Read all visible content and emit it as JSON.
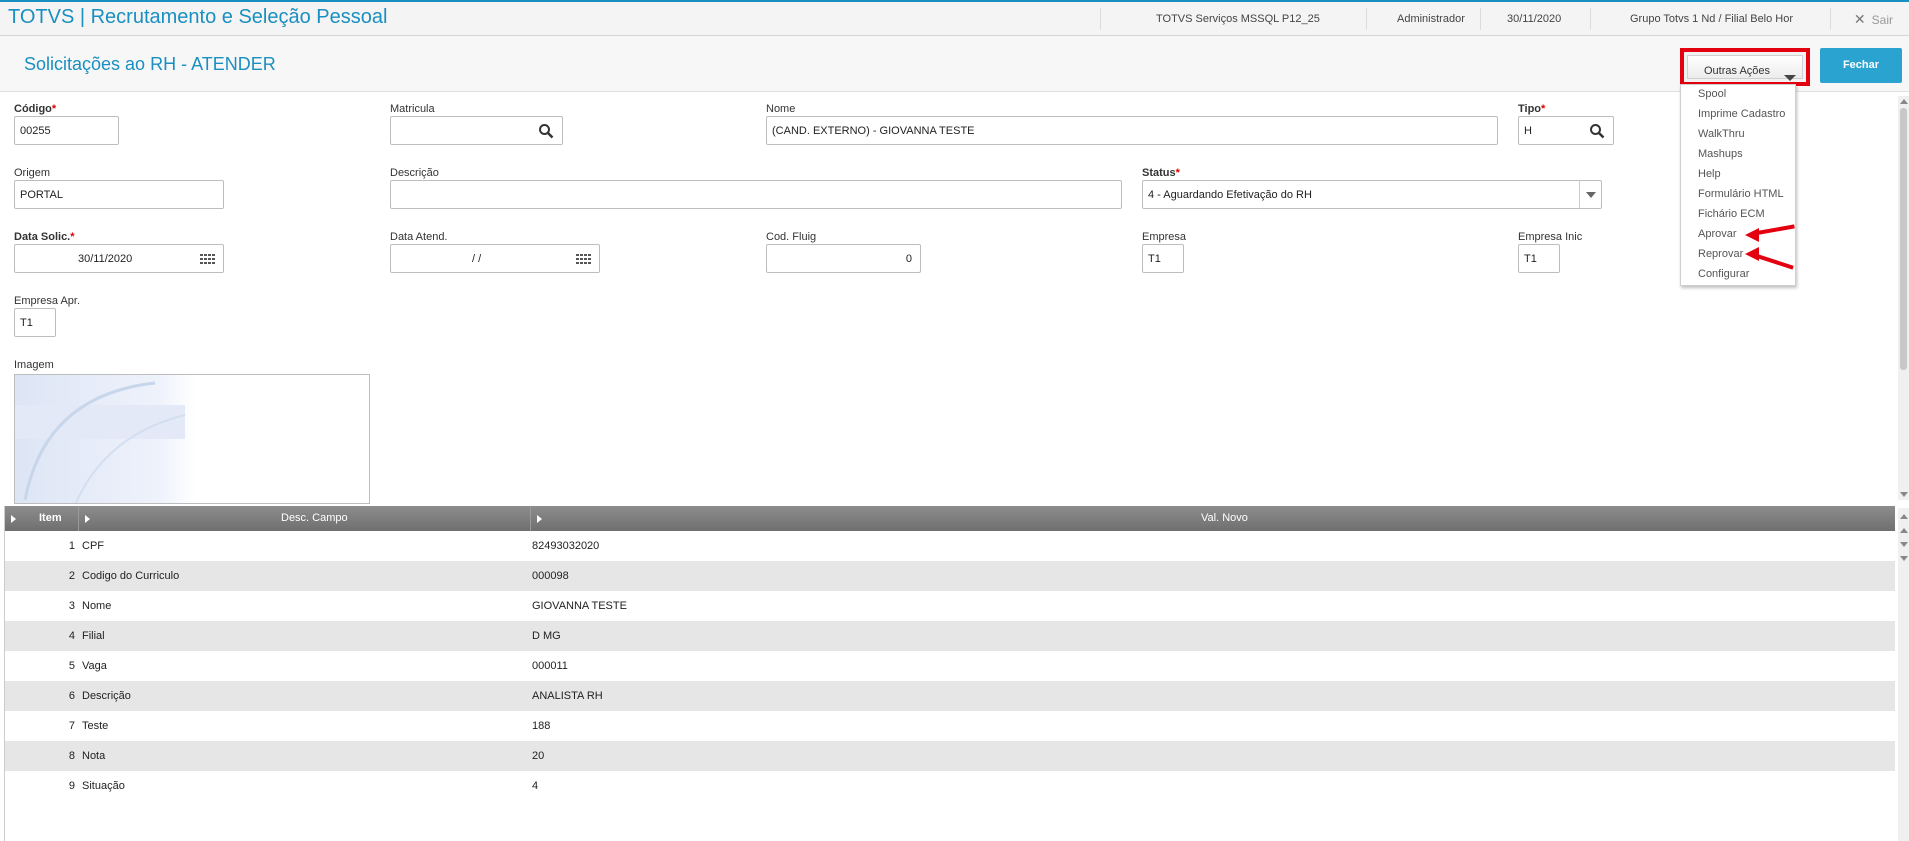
{
  "app": {
    "title": "TOTVS | Recrutamento e Seleção Pessoal",
    "environment": "TOTVS Serviços MSSQL P12_25",
    "user": "Administrador",
    "date": "30/11/2020",
    "branch": "Grupo Totvs 1 Nd / Filial Belo Hor",
    "exit_label": "Sair"
  },
  "page": {
    "title": "Solicitações ao RH - ATENDER",
    "actions_label": "Outras Ações",
    "close_label": "Fechar"
  },
  "actions_menu": {
    "items": [
      "Spool",
      "Imprime Cadastro",
      "WalkThru",
      "Mashups",
      "Help",
      "Formulário HTML",
      "Fichário ECM",
      "Aprovar",
      "Reprovar",
      "Configurar"
    ]
  },
  "form": {
    "codigo": {
      "label": "Código",
      "value": "00255"
    },
    "matricula": {
      "label": "Matricula",
      "value": ""
    },
    "nome": {
      "label": "Nome",
      "value": "(CAND. EXTERNO) - GIOVANNA  TESTE"
    },
    "tipo": {
      "label": "Tipo",
      "value": "H"
    },
    "origem": {
      "label": "Origem",
      "value": "PORTAL"
    },
    "descricao": {
      "label": "Descrição",
      "value": ""
    },
    "status": {
      "label": "Status",
      "value": "4 - Aguardando Efetivação do RH"
    },
    "data_solic": {
      "label": "Data Solic.",
      "value": "30/11/2020"
    },
    "data_atend": {
      "label": "Data Atend.",
      "value": "/  /"
    },
    "cod_fluig": {
      "label": "Cod. Fluig",
      "value": "0"
    },
    "empresa": {
      "label": "Empresa",
      "value": "T1"
    },
    "empresa_inic": {
      "label": "Empresa Inic",
      "value": "T1"
    },
    "empresa_apr": {
      "label": "Empresa Apr.",
      "value": "T1"
    },
    "imagem": {
      "label": "Imagem"
    }
  },
  "grid": {
    "headers": [
      "Item",
      "Desc. Campo",
      "Val. Novo"
    ],
    "rows": [
      {
        "item": "1",
        "campo": "CPF",
        "valor": "82493032020"
      },
      {
        "item": "2",
        "campo": "Codigo do Curriculo",
        "valor": "000098"
      },
      {
        "item": "3",
        "campo": "Nome",
        "valor": "GIOVANNA  TESTE"
      },
      {
        "item": "4",
        "campo": "Filial",
        "valor": "D MG"
      },
      {
        "item": "5",
        "campo": "Vaga",
        "valor": "000011"
      },
      {
        "item": "6",
        "campo": "Descrição",
        "valor": "ANALISTA RH"
      },
      {
        "item": "7",
        "campo": "Teste",
        "valor": "188"
      },
      {
        "item": "8",
        "campo": "Nota",
        "valor": "20"
      },
      {
        "item": "9",
        "campo": "Situação",
        "valor": "4"
      }
    ]
  },
  "colors": {
    "brand": "#1a8fc1",
    "button": "#2aa3d1",
    "highlight": "#e3000f",
    "required": "#dd0000",
    "grid_header": "#7a7a7a",
    "row_alt": "#e6e6e6"
  },
  "icons": [
    "close-icon",
    "search-icon",
    "calendar-icon",
    "chevron-down-icon",
    "triangle-right-icon",
    "arrow-left-icon"
  ]
}
